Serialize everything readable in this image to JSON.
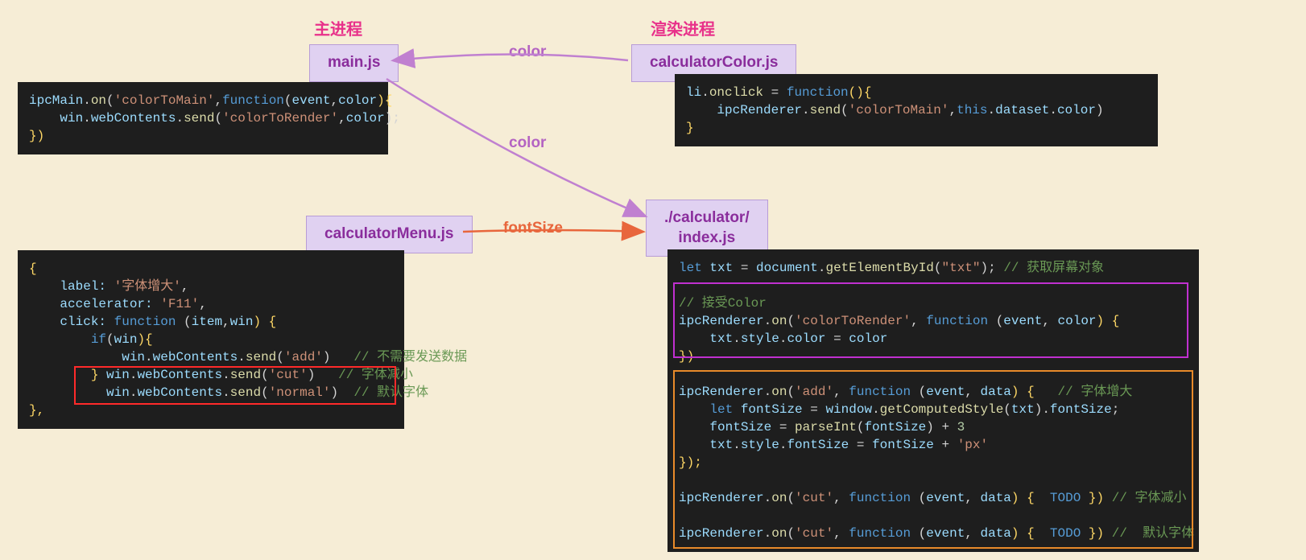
{
  "headers": {
    "main": "主进程",
    "render": "渲染进程"
  },
  "nodes": {
    "main_js": "main.js",
    "calc_color": "calculatorColor.js",
    "calc_menu": "calculatorMenu.js",
    "calc_index": "./calculator/\nindex.js"
  },
  "labels": {
    "color1": "color",
    "color2": "color",
    "fontSize": "fontSize"
  },
  "code": {
    "main_js": {
      "l1_a": "ipcMain",
      "l1_b": ".",
      "l1_c": "on",
      "l1_d": "(",
      "l1_e": "'colorToMain'",
      "l1_f": ",",
      "l1_g": "function",
      "l1_h": "(",
      "l1_i": "event",
      "l1_j": ",",
      "l1_k": "color",
      "l1_l": "){",
      "l2_a": "    ",
      "l2_b": "win",
      "l2_c": ".",
      "l2_d": "webContents",
      "l2_e": ".",
      "l2_f": "send",
      "l2_g": "(",
      "l2_h": "'colorToRender'",
      "l2_i": ",",
      "l2_j": "color",
      "l2_k": ");",
      "l3": "})"
    },
    "calc_color": {
      "l1_a": "li",
      "l1_b": ".",
      "l1_c": "onclick",
      "l1_d": " = ",
      "l1_e": "function",
      "l1_f": "(){",
      "l2_a": "    ",
      "l2_b": "ipcRenderer",
      "l2_c": ".",
      "l2_d": "send",
      "l2_e": "(",
      "l2_f": "'colorToMain'",
      "l2_g": ",",
      "l2_h": "this",
      "l2_i": ".",
      "l2_j": "dataset",
      "l2_k": ".",
      "l2_l": "color",
      "l2_m": ")",
      "l3": "}"
    },
    "calc_menu": {
      "l1": "{",
      "l2_a": "    ",
      "l2_b": "label:",
      "l2_c": " ",
      "l2_d": "'字体增大'",
      "l2_e": ",",
      "l3_a": "    ",
      "l3_b": "accelerator:",
      "l3_c": " ",
      "l3_d": "'F11'",
      "l3_e": ",",
      "l4_a": "    ",
      "l4_b": "click:",
      "l4_c": " ",
      "l4_d": "function",
      "l4_e": " (",
      "l4_f": "item",
      "l4_g": ",",
      "l4_h": "win",
      "l4_i": ") {",
      "l5_a": "        ",
      "l5_b": "if",
      "l5_c": "(",
      "l5_d": "win",
      "l5_e": "){",
      "l6_a": "            ",
      "l6_b": "win",
      "l6_c": ".",
      "l6_d": "webContents",
      "l6_e": ".",
      "l6_f": "send",
      "l6_g": "(",
      "l6_h": "'add'",
      "l6_i": ")   ",
      "l6_j": "// 不需要发送数据",
      "l7_a": "        ",
      "l7_b": "}",
      "l7c_a": " ",
      "l7c_b": "win",
      "l7c_c": ".",
      "l7c_d": "webContents",
      "l7c_e": ".",
      "l7c_f": "send",
      "l7c_g": "(",
      "l7c_h": "'cut'",
      "l7c_i": ")   ",
      "l7c_j": "// 字体减小",
      "l8_a": "          ",
      "l8_b": "win",
      "l8_c": ".",
      "l8_d": "webContents",
      "l8_e": ".",
      "l8_f": "send",
      "l8_g": "(",
      "l8_h": "'normal'",
      "l8_i": ")  ",
      "l8_j": "// 默认字体",
      "l9": "},"
    },
    "index_js": {
      "l1_a": "let",
      "l1_b": " ",
      "l1_c": "txt",
      "l1_d": " = ",
      "l1_e": "document",
      "l1_f": ".",
      "l1_g": "getElementById",
      "l1_h": "(",
      "l1_i": "\"txt\"",
      "l1_j": "); ",
      "l1_k": "// 获取屏幕对象",
      "l2": "",
      "l3": "// 接受Color",
      "l4_a": "ipcRenderer",
      "l4_b": ".",
      "l4_c": "on",
      "l4_d": "(",
      "l4_e": "'colorToRender'",
      "l4_f": ", ",
      "l4_g": "function",
      "l4_h": " (",
      "l4_i": "event",
      "l4_j": ", ",
      "l4_k": "color",
      "l4_l": ") {",
      "l5_a": "    ",
      "l5_b": "txt",
      "l5_c": ".",
      "l5_d": "style",
      "l5_e": ".",
      "l5_f": "color",
      "l5_g": " = ",
      "l5_h": "color",
      "l6": "})",
      "l7": "",
      "l8_a": "ipcRenderer",
      "l8_b": ".",
      "l8_c": "on",
      "l8_d": "(",
      "l8_e": "'add'",
      "l8_f": ", ",
      "l8_g": "function",
      "l8_h": " (",
      "l8_i": "event",
      "l8_j": ", ",
      "l8_k": "data",
      "l8_l": ") {   ",
      "l8_m": "// 字体增大",
      "l9_a": "    ",
      "l9_b": "let",
      "l9_c": " ",
      "l9_d": "fontSize",
      "l9_e": " = ",
      "l9_f": "window",
      "l9_g": ".",
      "l9_h": "getComputedStyle",
      "l9_i": "(",
      "l9_j": "txt",
      "l9_k": ").",
      "l9_l": "fontSize",
      "l9_m": ";",
      "l10_a": "    ",
      "l10_b": "fontSize",
      "l10_c": " = ",
      "l10_d": "parseInt",
      "l10_e": "(",
      "l10_f": "fontSize",
      "l10_g": ") + ",
      "l10_h": "3",
      "l11_a": "    ",
      "l11_b": "txt",
      "l11_c": ".",
      "l11_d": "style",
      "l11_e": ".",
      "l11_f": "fontSize",
      "l11_g": " = ",
      "l11_h": "fontSize",
      "l11_i": " + ",
      "l11_j": "'px'",
      "l12": "});",
      "l13": "",
      "l14_a": "ipcRenderer",
      "l14_b": ".",
      "l14_c": "on",
      "l14_d": "(",
      "l14_e": "'cut'",
      "l14_f": ", ",
      "l14_g": "function",
      "l14_h": " (",
      "l14_i": "event",
      "l14_j": ", ",
      "l14_k": "data",
      "l14_l": ") {  ",
      "l14_m": "TODO",
      "l14_n": " }) ",
      "l14_o": "// 字体减小",
      "l15": "",
      "l16_a": "ipcRenderer",
      "l16_b": ".",
      "l16_c": "on",
      "l16_d": "(",
      "l16_e": "'cut'",
      "l16_f": ", ",
      "l16_g": "function",
      "l16_h": " (",
      "l16_i": "event",
      "l16_j": ", ",
      "l16_k": "data",
      "l16_l": ") {  ",
      "l16_m": "TODO",
      "l16_n": " }) ",
      "l16_o": "//  默认字体"
    }
  }
}
